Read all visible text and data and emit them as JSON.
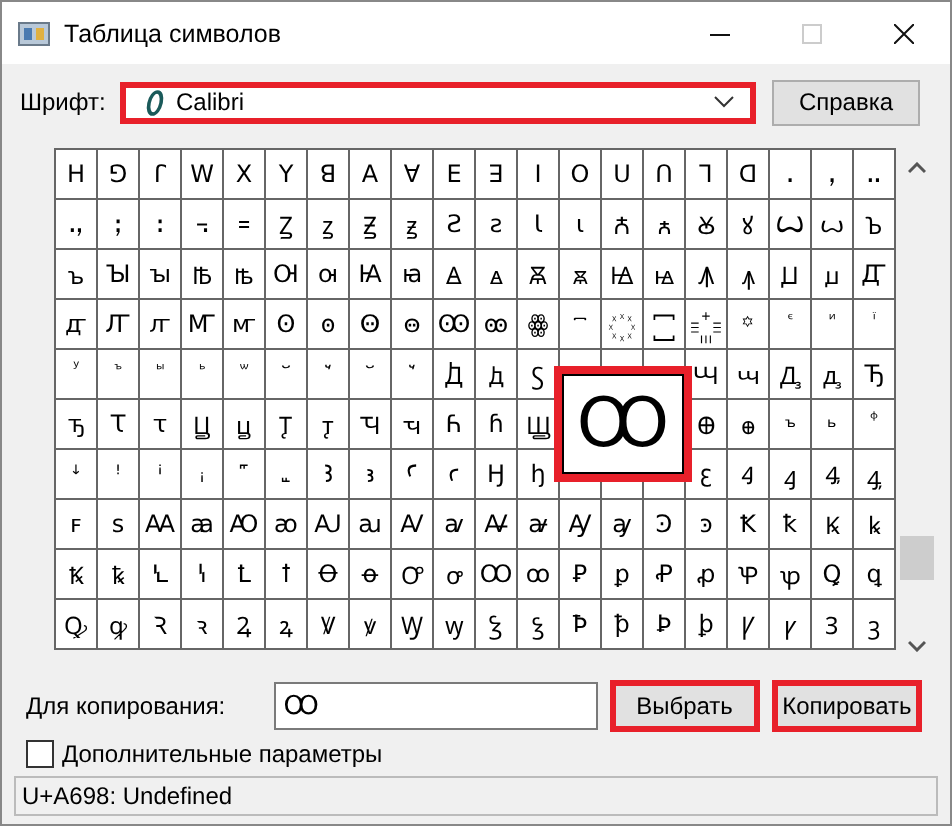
{
  "window": {
    "title": "Таблица символов"
  },
  "title_buttons": [
    {
      "kind": "minimize",
      "disabled": false
    },
    {
      "kind": "maximize",
      "disabled": true
    },
    {
      "kind": "close",
      "disabled": false
    }
  ],
  "font": {
    "label": "Шрифт:",
    "value": "Calibri",
    "highlighted": true
  },
  "help_button": {
    "label": "Справка",
    "highlighted": false
  },
  "grid": {
    "rows": [
      [
        "ꓧ",
        "ꓨ",
        "ꓩ",
        "ꓪ",
        "ꓫ",
        "ꓬ",
        "ꓭ",
        "ꓮ",
        "ꓯ",
        "ꓰ",
        "ꓱ",
        "ꓲ",
        "ꓳ",
        "ꓴ",
        "ꓵ",
        "ꓶ",
        "ꓷ",
        "ꓸ",
        "ꓹ",
        "ꓺ"
      ],
      [
        "ꓻ",
        "ꓼ",
        "ꓽ",
        "꓾",
        "꓿",
        "Ꙁ",
        "ꙁ",
        "Ꙃ",
        "ꙃ",
        "Ꙅ",
        "ꙅ",
        "Ꙇ",
        "ꙇ",
        "Ꙉ",
        "ꙉ",
        "Ꙋ",
        "ꙋ",
        "Ꙍ",
        "ꙍ",
        "Ꙏ"
      ],
      [
        "ꙏ",
        "Ꙑ",
        "ꙑ",
        "Ꙓ",
        "ꙓ",
        "Ꙕ",
        "ꙕ",
        "Ꙗ",
        "ꙗ",
        "Ꙙ",
        "ꙙ",
        "Ꙛ",
        "ꙛ",
        "Ꙝ",
        "ꙝ",
        "Ꙟ",
        "ꙟ",
        "Ꙡ",
        "ꙡ",
        "Ꙣ"
      ],
      [
        "ꙣ",
        "Ꙥ",
        "ꙥ",
        "Ꙧ",
        "ꙧ",
        "Ꙩ",
        "ꙩ",
        "Ꙫ",
        "ꙫ",
        "Ꙭ",
        "ꙭ",
        "ꙮ",
        "꙯",
        "꙰",
        "꙱",
        "꙲",
        "꙳",
        "ꙴ",
        "ꙵ",
        "ꙶ"
      ],
      [
        "ꙷ",
        "ꙸ",
        "ꙹ",
        "ꙺ",
        "ꙻ",
        "꙼",
        "꙽",
        "꙾",
        "ꙿ",
        "Ꚁ",
        "ꚁ",
        "Ꚃ",
        null,
        null,
        null,
        "Ꚇ",
        "ꚇ",
        "Ꚉ",
        "ꚉ",
        "Ꚋ"
      ],
      [
        "ꚋ",
        "Ꚍ",
        "ꚍ",
        "Ꚏ",
        "ꚏ",
        "Ꚑ",
        "ꚑ",
        "Ꚓ",
        "ꚓ",
        "Ꚕ",
        "ꚕ",
        "Ꚗ",
        null,
        null,
        null,
        "Ꚛ",
        "ꚛ",
        "ꚜ",
        "ꚝ",
        "ꚞ"
      ],
      [
        "ꜜ",
        "ꜝ",
        "ꜞ",
        "ꜟ",
        "꜠",
        "꜡",
        "Ꜣ",
        "ꜣ",
        "Ꜥ",
        "ꜥ",
        "Ꜧ",
        "ꜧ",
        null,
        null,
        null,
        "ꜫ",
        "Ꜭ",
        "ꜭ",
        "Ꜯ",
        "ꜯ"
      ],
      [
        "ꜰ",
        "ꜱ",
        "Ꜳ",
        "ꜳ",
        "Ꜵ",
        "ꜵ",
        "Ꜷ",
        "ꜷ",
        "Ꜹ",
        "ꜹ",
        "Ꜻ",
        "ꜻ",
        "Ꜽ",
        "ꜽ",
        "Ꜿ",
        "ꜿ",
        "Ꝁ",
        "ꝁ",
        "Ꝃ",
        "ꝃ"
      ],
      [
        "Ꝅ",
        "ꝅ",
        "Ꝇ",
        "ꝇ",
        "Ꝉ",
        "ꝉ",
        "Ꝋ",
        "ꝋ",
        "Ꝍ",
        "ꝍ",
        "Ꝏ",
        "ꝏ",
        "Ꝑ",
        "ꝑ",
        "Ꝓ",
        "ꝓ",
        "Ꝕ",
        "ꝕ",
        "Ꝗ",
        "ꝗ"
      ],
      [
        "Ꝙ",
        "ꝙ",
        "Ꝛ",
        "ꝛ",
        "Ꝝ",
        "ꝝ",
        "Ꝟ",
        "ꝟ",
        "Ꝡ",
        "ꝡ",
        "Ꝣ",
        "ꝣ",
        "Ꝥ",
        "ꝥ",
        "Ꝧ",
        "ꝧ",
        "Ꝩ",
        "ꝩ",
        "Ꝫ",
        "ꝫ"
      ]
    ]
  },
  "magnifier": {
    "text": "Ꚙ",
    "highlighted": true
  },
  "copy": {
    "label": "Для копирования:",
    "value": "Ꚙ"
  },
  "buttons": [
    {
      "label": "Выбрать",
      "highlighted": true
    },
    {
      "label": "Копировать",
      "highlighted": true
    }
  ],
  "advanced": {
    "label": "Дополнительные параметры",
    "checked": false
  },
  "status_bar": "U+A698: Undefined"
}
